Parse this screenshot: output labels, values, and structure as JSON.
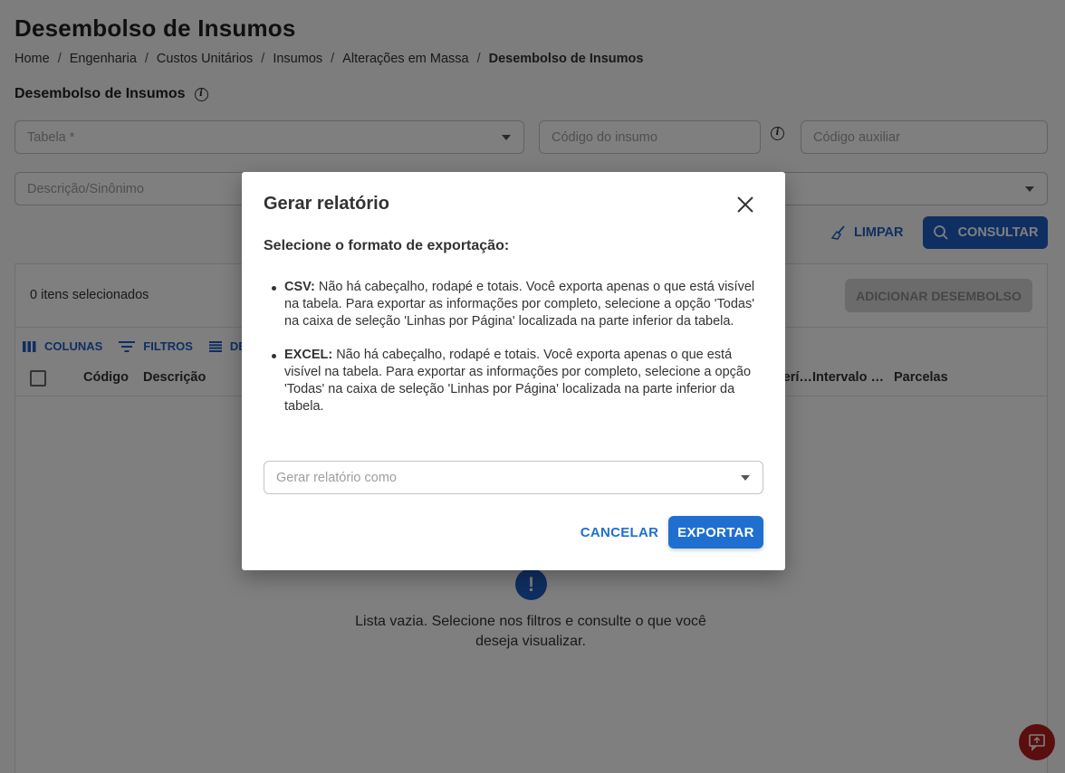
{
  "page": {
    "title": "Desembolso de Insumos",
    "breadcrumb": [
      "Home",
      "Engenharia",
      "Custos Unitários",
      "Insumos",
      "Alterações em Massa",
      "Desembolso de Insumos"
    ],
    "breadcrumb_separator": "/",
    "section_title": "Desembolso de Insumos"
  },
  "filters": {
    "tabela_placeholder": "Tabela *",
    "codigo_insumo_placeholder": "Código do insumo",
    "codigo_auxiliar_placeholder": "Código auxiliar",
    "descricao_placeholder": "Descrição/Sinônimo"
  },
  "actions": {
    "limpar_label": "LIMPAR",
    "consultar_label": "CONSULTAR"
  },
  "table": {
    "selected_count": "0 itens selecionados",
    "add_button": "ADICIONAR DESEMBOLSO",
    "toolbar": {
      "colunas": "COLUNAS",
      "filtros": "FILTROS",
      "densidade": "DE"
    },
    "columns": [
      "Código",
      "Descrição",
      "Perí…",
      "Intervalo …",
      "Parcelas"
    ],
    "empty_icon": "!",
    "empty_message": "Lista vazia. Selecione nos filtros e consulte o que você deseja visualizar."
  },
  "modal": {
    "title": "Gerar relatório",
    "subtitle": "Selecione o formato de exportação:",
    "options": [
      {
        "name": "CSV:",
        "text": "Não há cabeçalho, rodapé e totais. Você exporta apenas o que está visível na tabela. Para exportar as informações por completo, selecione a opção 'Todas' na caixa de seleção 'Linhas por Página' localizada na parte inferior da tabela."
      },
      {
        "name": "EXCEL:",
        "text": "Não há cabeçalho, rodapé e totais. Você exporta apenas o que está visível na tabela. Para exportar as informações por completo, selecione a opção 'Todas' na caixa de seleção 'Linhas por Página' localizada na parte inferior da tabela."
      }
    ],
    "select_placeholder": "Gerar relatório como",
    "cancel_label": "CANCELAR",
    "export_label": "EXPORTAR"
  },
  "colors": {
    "primary": "#1f5fc4",
    "modal_primary": "#1f6fd1",
    "fab": "#b71c1c",
    "disabled": "#d6d6d6"
  },
  "icons": [
    "info-icon",
    "caret-down-icon",
    "broom-icon",
    "search-icon",
    "columns-icon",
    "filter-icon",
    "density-icon",
    "close-icon",
    "feedback-icon"
  ]
}
